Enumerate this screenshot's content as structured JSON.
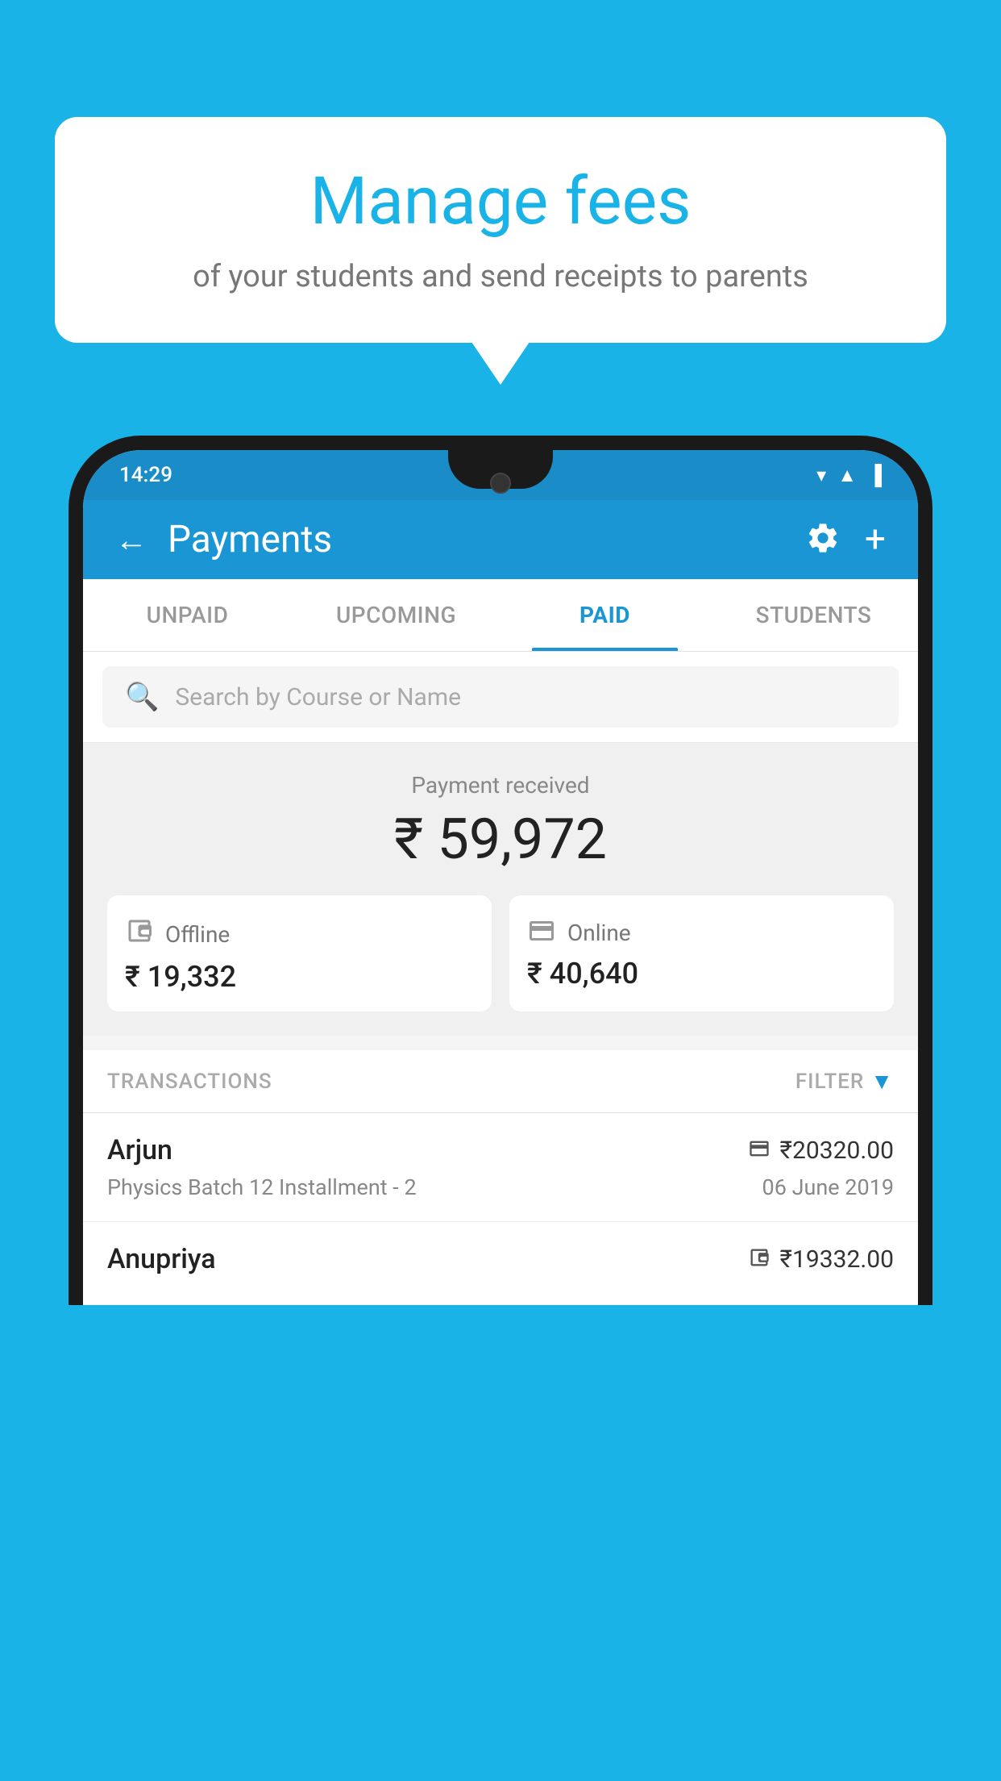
{
  "background_color": "#1ab3e8",
  "speech_bubble": {
    "title": "Manage fees",
    "subtitle": "of your students and send receipts to parents"
  },
  "status_bar": {
    "time": "14:29",
    "wifi": "▼",
    "signal": "▲",
    "battery": "▐"
  },
  "header": {
    "title": "Payments",
    "back_label": "←",
    "settings_label": "⚙",
    "add_label": "+"
  },
  "tabs": [
    {
      "label": "UNPAID",
      "active": false
    },
    {
      "label": "UPCOMING",
      "active": false
    },
    {
      "label": "PAID",
      "active": true
    },
    {
      "label": "STUDENTS",
      "active": false
    }
  ],
  "search": {
    "placeholder": "Search by Course or Name"
  },
  "payment_summary": {
    "label": "Payment received",
    "amount": "₹ 59,972",
    "offline_label": "Offline",
    "offline_amount": "₹ 19,332",
    "online_label": "Online",
    "online_amount": "₹ 40,640"
  },
  "transactions": {
    "header": "TRANSACTIONS",
    "filter": "FILTER",
    "rows": [
      {
        "name": "Arjun",
        "payment_type": "card",
        "amount": "₹20320.00",
        "course": "Physics Batch 12 Installment - 2",
        "date": "06 June 2019"
      },
      {
        "name": "Anupriya",
        "payment_type": "cash",
        "amount": "₹19332.00",
        "course": "",
        "date": ""
      }
    ]
  }
}
